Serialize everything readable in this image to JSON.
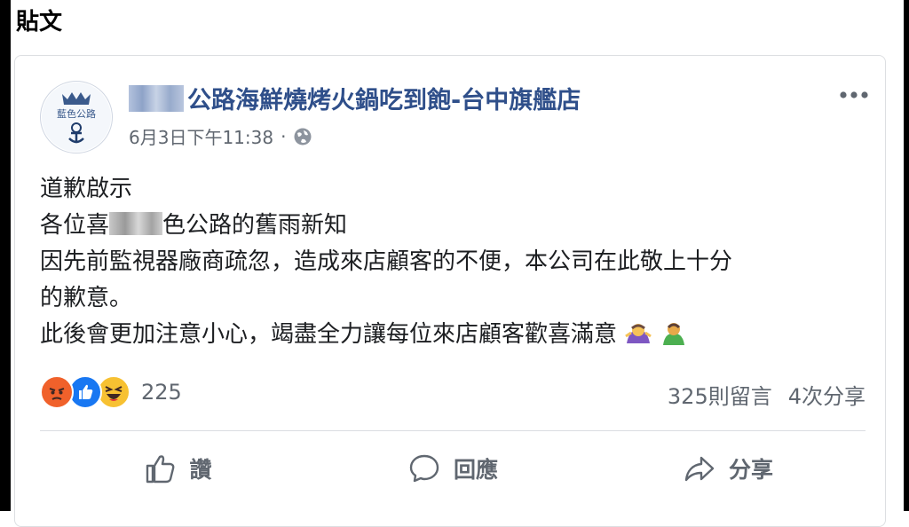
{
  "header": {
    "label": "貼文"
  },
  "post": {
    "page_name_suffix": "公路海鮮燒烤火鍋吃到飽-台中旗艦店",
    "avatar_text": "藍色公路",
    "timestamp": "6月3日下午11:38",
    "meta_separator": "·",
    "lines": {
      "l1": "道歉啟示",
      "l2_pre": "各位喜",
      "l2_post": "色公路的舊雨新知",
      "l3": "因先前監視器廠商疏忽，造成來店顧客的不便，本公司在此敬上十分",
      "l4": "的歉意。",
      "l5": "此後會更加注意小心，竭盡全力讓每位來店顧客歡喜滿意"
    },
    "reactions": {
      "count": "225",
      "icons": [
        "angry-icon",
        "like-icon",
        "haha-icon"
      ]
    },
    "stats": {
      "comments": "325則留言",
      "shares": "4次分享"
    },
    "actions": {
      "like": "讚",
      "comment": "回應",
      "share": "分享"
    }
  },
  "colors": {
    "page_name": "#2f4f8a",
    "meta_text": "#606770",
    "body_text": "#1c1e21",
    "like_blue": "#1877f2",
    "angry_orange": "#f0612b",
    "haha_yellow": "#f7c132"
  }
}
